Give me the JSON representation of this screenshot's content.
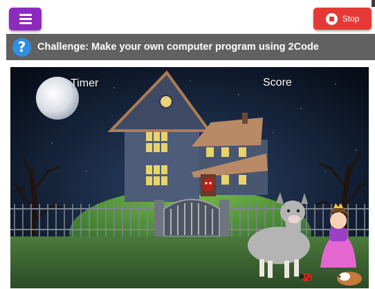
{
  "toolbar": {
    "menu_icon": "hamburger-menu-icon",
    "stop_label": "Stop",
    "stop_icon": "stop-circle-icon",
    "stop_color": "#e53935",
    "menu_color": "#8e2bbf"
  },
  "challenge": {
    "icon": "question-circle-icon",
    "text": "Challenge: Make your own computer program using 2Code"
  },
  "stage": {
    "timer_label": "Timer",
    "score_label": "Score",
    "sprites": [
      "moon",
      "haunted-house",
      "ghost",
      "llama",
      "princess",
      "ladybird",
      "guinea-pig"
    ]
  }
}
